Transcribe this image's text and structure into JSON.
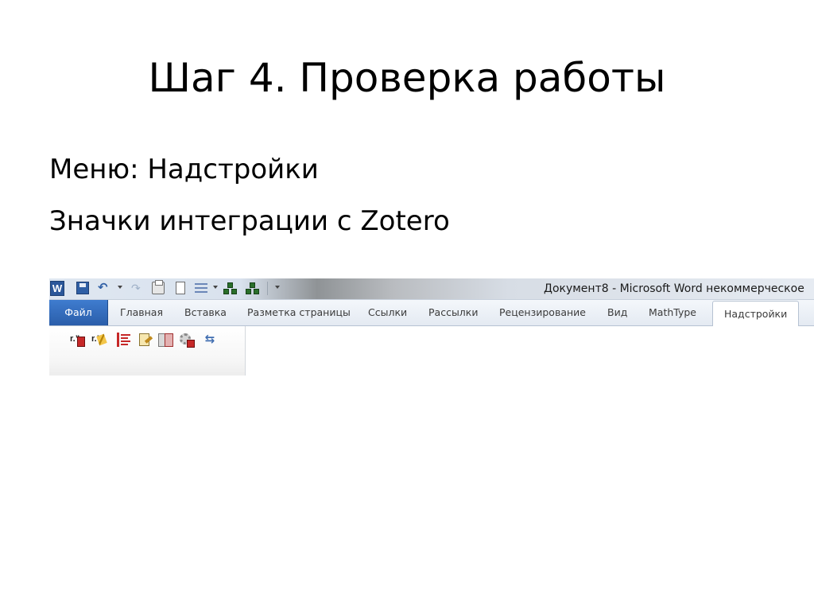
{
  "slide": {
    "title": "Шаг 4. Проверка работы",
    "bullets": [
      "Меню: Надстройки",
      "Значки интеграции с Zotero"
    ]
  },
  "word": {
    "logo": "W",
    "window_title": "Документ8 - Microsoft Word некоммерческое",
    "tabs": {
      "file": "Файл",
      "home": "Главная",
      "insert": "Вставка",
      "page_layout": "Разметка страницы",
      "references": "Ссылки",
      "mailings": "Рассылки",
      "review": "Рецензирование",
      "view": "Вид",
      "mathtype": "MathType",
      "addins": "Надстройки"
    },
    "active_tab": "Надстройки",
    "colors": {
      "file_tab": "#2a5eaa",
      "zotero_red": "#c62828"
    },
    "quick_access_icons": [
      "word-logo-icon",
      "save-icon",
      "undo-icon",
      "redo-icon",
      "quick-print-icon",
      "new-document-icon",
      "list-icon",
      "tree-icon",
      "tree-icon",
      "customize-icon"
    ],
    "zotero_icons": [
      "insert-citation-icon",
      "edit-citation-icon",
      "insert-bibliography-icon",
      "edit-bibliography-icon",
      "set-preferences-icon",
      "refresh-icon",
      "remove-codes-icon"
    ]
  }
}
